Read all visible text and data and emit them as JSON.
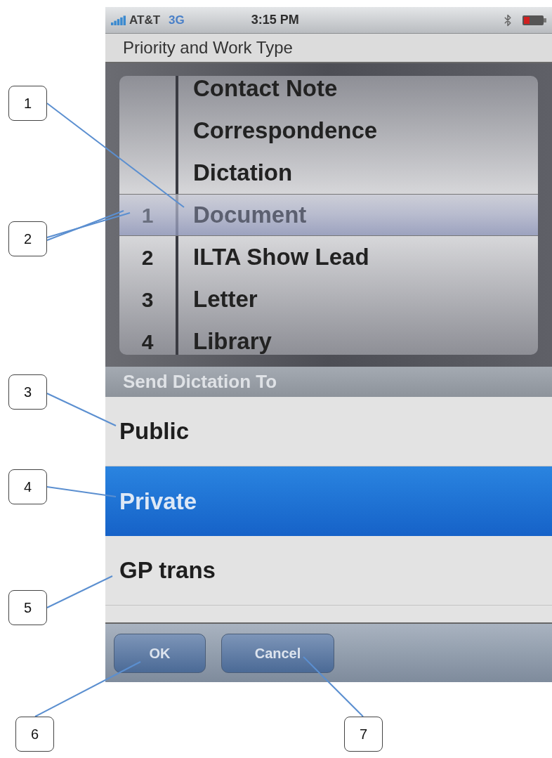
{
  "status_bar": {
    "carrier": "AT&T",
    "network": "3G",
    "time": "3:15 PM"
  },
  "title": "Priority and Work Type",
  "picker": {
    "rows": [
      {
        "label": "Contact Note",
        "selected": false
      },
      {
        "label": "Correspondence",
        "selected": false
      },
      {
        "label": "Dictation",
        "selected": false
      },
      {
        "number": "1",
        "label": "Document",
        "selected": true
      },
      {
        "number": "2",
        "label": "ILTA Show Lead",
        "selected": false
      },
      {
        "number": "3",
        "label": "Letter",
        "selected": false
      },
      {
        "number": "4",
        "label": "Library",
        "selected": false
      }
    ]
  },
  "section_header": "Send Dictation To",
  "destinations": [
    {
      "label": "Public",
      "selected": false
    },
    {
      "label": "Private",
      "selected": true
    },
    {
      "label": "GP trans",
      "selected": false
    }
  ],
  "buttons": [
    "OK",
    "Cancel"
  ],
  "callouts": [
    "1",
    "2",
    "3",
    "4",
    "5",
    "6",
    "7"
  ]
}
